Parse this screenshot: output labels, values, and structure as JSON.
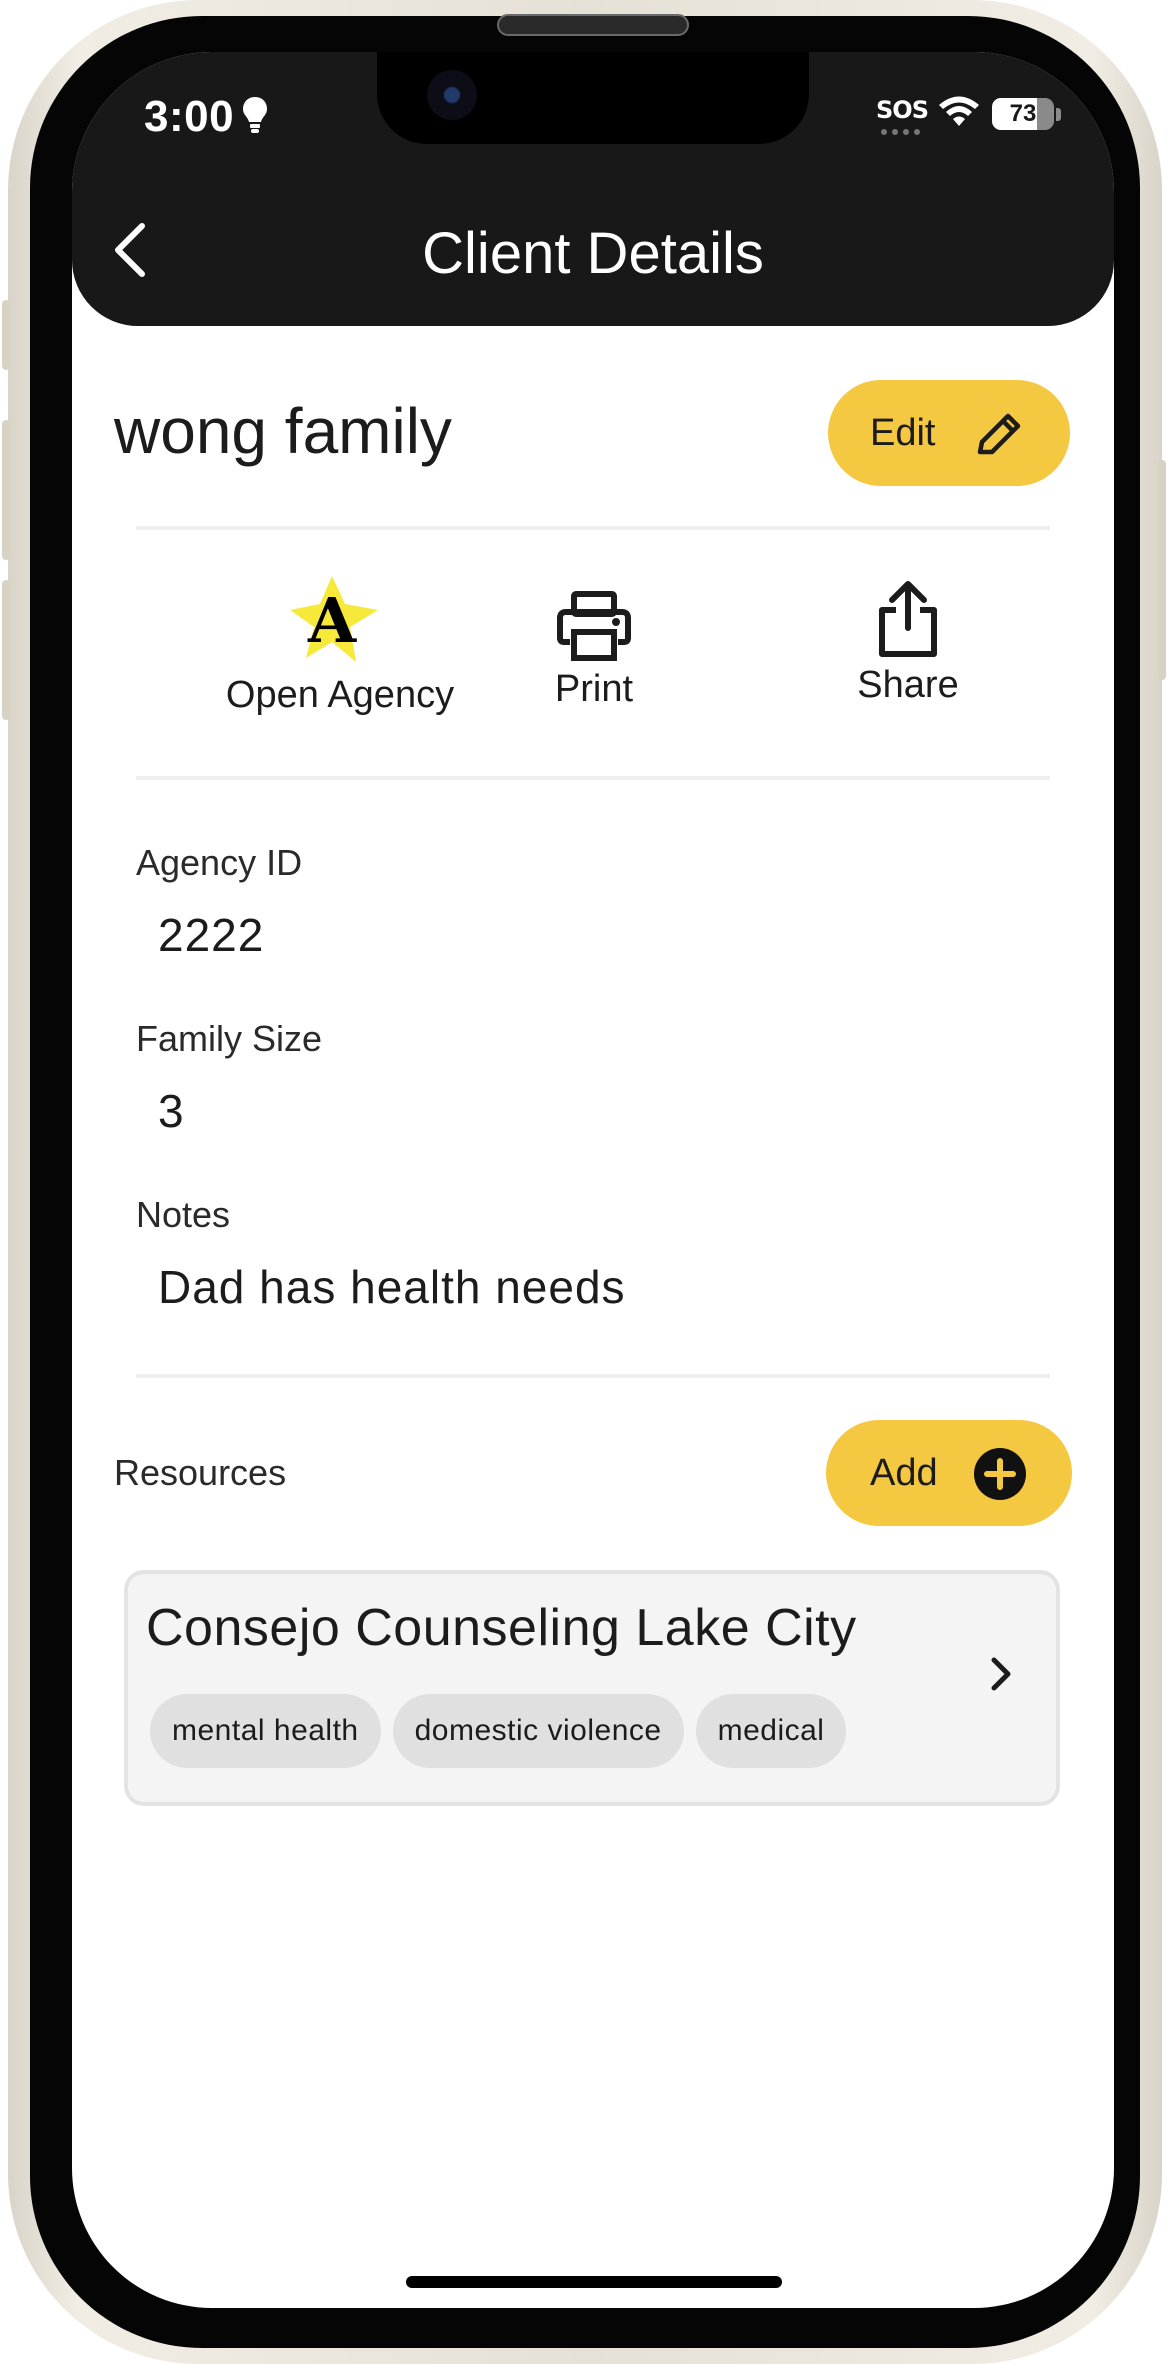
{
  "status_bar": {
    "time": "3:00",
    "sos": "SOS",
    "battery": "73",
    "battery_level_percent": 73,
    "icons": [
      "bulb-icon",
      "wifi-icon",
      "battery-icon"
    ]
  },
  "header": {
    "title": "Client Details",
    "back_icon": "chevron-left-icon"
  },
  "client": {
    "name": "wong family",
    "edit_label": "Edit",
    "edit_icon": "pencil-icon"
  },
  "actions": [
    {
      "label": "Open Agency",
      "icon": "agency-star-logo-icon"
    },
    {
      "label": "Print",
      "icon": "printer-icon"
    },
    {
      "label": "Share",
      "icon": "share-icon"
    }
  ],
  "agency_logo_letter": "A",
  "fields": [
    {
      "label": "Agency ID",
      "value": "2222"
    },
    {
      "label": "Family Size",
      "value": "3"
    },
    {
      "label": "Notes",
      "value": "Dad has health needs"
    }
  ],
  "resources": {
    "label": "Resources",
    "add_label": "Add",
    "add_icon": "plus-circle-icon",
    "items": [
      {
        "name": "Consejo Counseling Lake City",
        "tags": [
          "mental health",
          "domestic violence",
          "medical"
        ]
      }
    ]
  },
  "colors": {
    "accent": "#f5c842",
    "header_bg": "#181818",
    "card_bg": "#f4f4f4",
    "tag_bg": "#e0e0e0"
  }
}
